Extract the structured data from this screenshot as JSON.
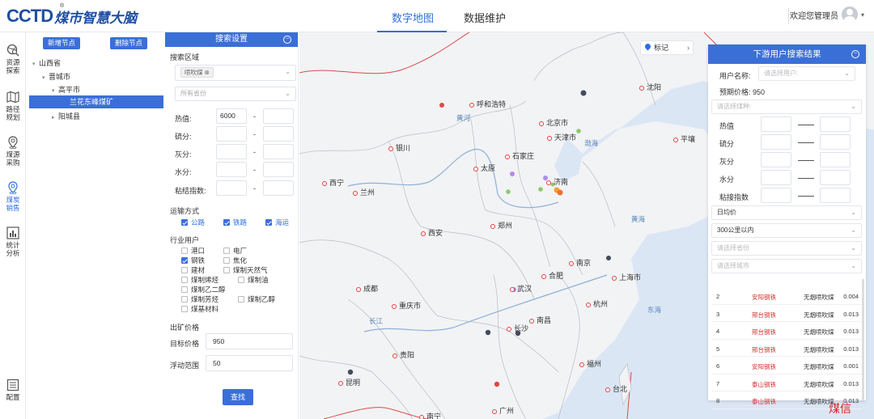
{
  "header": {
    "logo_mark": "CCTD",
    "logo_reg": "®",
    "logo_text": "煤市智慧大脑",
    "tabs": [
      {
        "label": "数字地图",
        "active": true
      },
      {
        "label": "数据维护",
        "active": false
      }
    ],
    "user_greeting": "欢迎您管理员",
    "accent_color": "#2f6fe0"
  },
  "rail": [
    {
      "label": "资源\n探索",
      "icon": "globe-search-icon"
    },
    {
      "label": "路径\n规划",
      "icon": "map-fold-icon"
    },
    {
      "label": "煤源\n采购",
      "icon": "location-pin-icon"
    },
    {
      "label": "煤炭\n销售",
      "icon": "location-pin-icon",
      "active": true
    },
    {
      "label": "统计\n分析",
      "icon": "bar-chart-icon"
    },
    {
      "label": "配置",
      "icon": "config-icon"
    }
  ],
  "tree": {
    "add_node": "新增节点",
    "delete_node": "删除节点",
    "nodes": [
      "山西省",
      "晋城市",
      "高平市",
      "兰花东峰煤矿",
      "阳城县"
    ]
  },
  "search": {
    "title": "搜索设置",
    "area_label": "搜索区域",
    "area_chip": "喷吹煤",
    "province_placeholder": "所有省份",
    "rows": [
      {
        "label": "热值:",
        "min": "6000",
        "max": ""
      },
      {
        "label": "硫分:",
        "min": "",
        "max": ""
      },
      {
        "label": "灰分:",
        "min": "",
        "max": ""
      },
      {
        "label": "水分:",
        "min": "",
        "max": ""
      },
      {
        "label": "粘结指数:",
        "min": "",
        "max": ""
      }
    ],
    "range_dash": "-",
    "transport_label": "运输方式",
    "transport": [
      "公路",
      "铁路",
      "海运"
    ],
    "industry_label": "行业用户",
    "industry": [
      "港口",
      "电厂",
      "钢铁",
      "焦化",
      "建材",
      "煤制天然气",
      "煤制烯烃",
      "煤制油",
      "煤制乙二醇",
      "煤制芳烃",
      "煤制乙醇",
      "煤基材料"
    ],
    "price_label": "出矿价格",
    "target_price_label": "目标价格",
    "target_price": "950",
    "float_label": "浮动范围",
    "float_value": "50",
    "search_button": "查找"
  },
  "map": {
    "mark_button": "标记",
    "cities": [
      "呼和浩特",
      "北京市",
      "沈阳",
      "天津市",
      "石家庄",
      "银川",
      "太原",
      "济南",
      "西宁",
      "兰州",
      "郑州",
      "西安",
      "南京",
      "合肥",
      "上海市",
      "成都",
      "武汉",
      "重庆市",
      "杭州",
      "长沙",
      "南昌",
      "贵阳",
      "福州",
      "昆明",
      "广州",
      "台北",
      "南宁",
      "平壤"
    ],
    "waters": [
      "黄河",
      "渤海",
      "黄海",
      "东海",
      "长江"
    ]
  },
  "results": {
    "title": "下游用户搜索结果",
    "user_name_label": "用户名称:",
    "user_name_placeholder": "请选择用户:",
    "expected_price_label": "预期价格:",
    "expected_price": "950",
    "coal_type_placeholder": "请选择煤种:",
    "metrics": [
      "热值",
      "硫分",
      "灰分",
      "水分",
      "粘接指数"
    ],
    "selects": [
      {
        "value": "日均价",
        "filled": true
      },
      {
        "value": "300公里以内",
        "filled": true
      },
      {
        "value": "请选择省份",
        "filled": false
      },
      {
        "value": "请选择城市",
        "filled": false
      }
    ],
    "rows": [
      {
        "idx": "2",
        "name": "安阳钢铁",
        "kind": "无烟喷吹煤",
        "val": "0.004"
      },
      {
        "idx": "3",
        "name": "邢台钢铁",
        "kind": "无烟喷吹煤",
        "val": "0.013"
      },
      {
        "idx": "4",
        "name": "邢台钢铁",
        "kind": "无烟喷吹煤",
        "val": "0.013"
      },
      {
        "idx": "5",
        "name": "邢台钢铁",
        "kind": "无烟喷吹煤",
        "val": "0.013"
      },
      {
        "idx": "6",
        "name": "安阳钢铁",
        "kind": "无烟喷吹煤",
        "val": "0.001"
      },
      {
        "idx": "7",
        "name": "泰山钢铁",
        "kind": "无烟喷吹煤",
        "val": "0.013"
      },
      {
        "idx": "8",
        "name": "泰山钢铁",
        "kind": "无烟喷吹煤",
        "val": "0.013"
      }
    ]
  },
  "watermark": "煤信"
}
